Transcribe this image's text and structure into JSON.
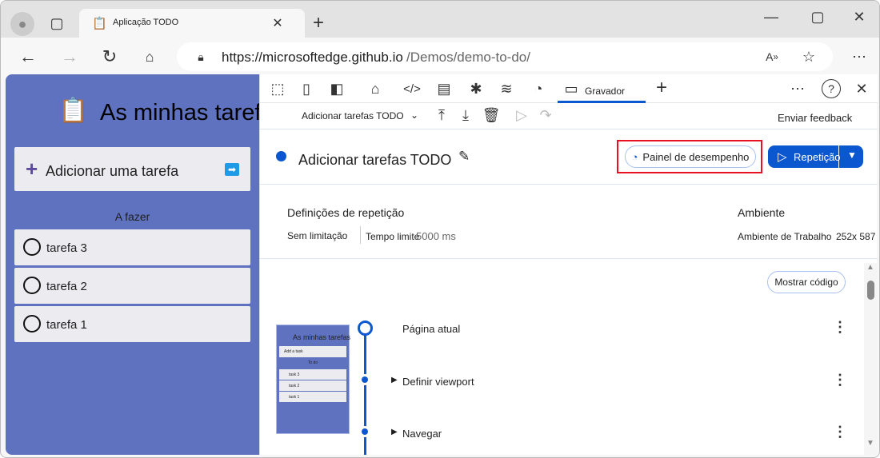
{
  "browser": {
    "tab_title": "Aplicação TODO",
    "url_host": "https://microsoftedge.github.io",
    "url_path": "/Demos/demo-to-do/"
  },
  "app": {
    "title": "As minhas tarefas",
    "add_label": "Adicionar uma tarefa",
    "section": "A fazer",
    "tasks": [
      "tarefa 3",
      "tarefa 2",
      "tarefa 1"
    ],
    "bg_color": "#5f72c0"
  },
  "devtools": {
    "active_tab": "Gravador",
    "recording_select": "Adicionar tarefas TODO",
    "feedback": "Enviar feedback",
    "recording_title": "Adicionar tarefas TODO",
    "perf_button": "Painel de desempenho",
    "replay_button": "Repetição",
    "settings_heading": "Definições de repetição",
    "throttling": "Sem limitação",
    "timeout_label": "Tempo limite",
    "timeout_value": "5000 ms",
    "env_heading": "Ambiente",
    "env_value": "Ambiente de Trabalho",
    "env_size": "252x 587",
    "show_code": "Mostrar código",
    "steps": [
      "Página atual",
      "Definir viewport",
      "Navegar"
    ],
    "thumb": {
      "title": "As minhas tarefas",
      "add": "Add a task",
      "section": "To do",
      "tasks": [
        "task 3",
        "task 2",
        "task 1"
      ]
    },
    "accent": "#0b57d0",
    "highlight": "#e81123"
  }
}
